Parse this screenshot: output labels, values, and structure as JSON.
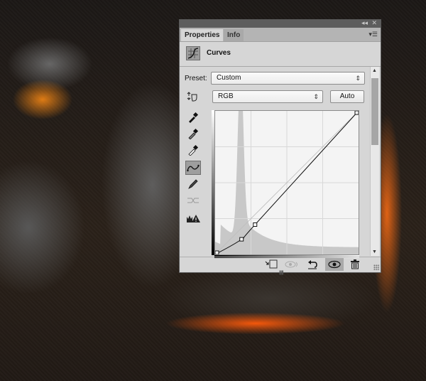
{
  "panel": {
    "tabs": [
      {
        "label": "Properties",
        "active": true
      },
      {
        "label": "Info",
        "active": false
      }
    ],
    "header": {
      "title": "Curves",
      "icon": "curves-adjustment-icon"
    },
    "preset": {
      "label": "Preset:",
      "value": "Custom"
    },
    "channel": {
      "value": "RGB"
    },
    "auto_label": "Auto",
    "tools": [
      {
        "name": "on-image-adjust-icon"
      },
      {
        "name": "black-point-eyedropper-icon"
      },
      {
        "name": "gray-point-eyedropper-icon"
      },
      {
        "name": "white-point-eyedropper-icon"
      },
      {
        "name": "curve-points-icon",
        "selected": true
      },
      {
        "name": "pencil-draw-icon"
      },
      {
        "name": "smooth-curve-icon",
        "disabled": true
      },
      {
        "name": "clipping-warning-icon"
      }
    ],
    "curve": {
      "points": [
        [
          0,
          0
        ],
        [
          47,
          27
        ],
        [
          71,
          53
        ],
        [
          255,
          255
        ]
      ],
      "histogram_peak_input": 45
    },
    "bottom_toolbar": [
      {
        "name": "clip-to-layer-icon"
      },
      {
        "name": "view-previous-state-icon",
        "disabled": true
      },
      {
        "name": "reset-icon"
      },
      {
        "name": "visibility-eye-icon",
        "on": true
      },
      {
        "name": "trash-icon"
      }
    ]
  }
}
